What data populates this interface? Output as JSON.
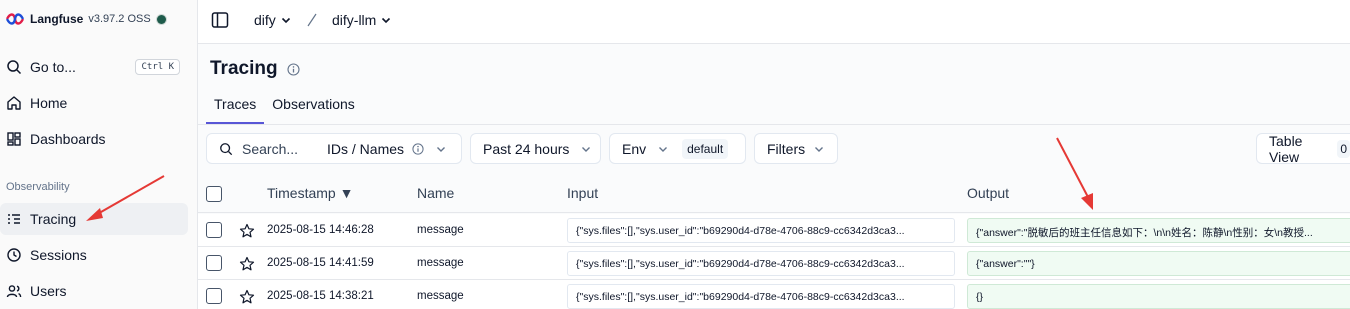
{
  "brand": {
    "name": "Langfuse",
    "version": "v3.97.2 OSS",
    "logo_icon": "langfuse-logo-icon",
    "status_color": "#1e5b4b"
  },
  "sidebar": {
    "goto": {
      "label": "Go to...",
      "shortcut": "Ctrl K",
      "icon": "search-icon"
    },
    "items": [
      {
        "label": "Home",
        "icon": "home-icon"
      },
      {
        "label": "Dashboards",
        "icon": "dashboard-icon"
      }
    ],
    "section_label": "Observability",
    "section_items": [
      {
        "label": "Tracing",
        "icon": "tracing-icon",
        "active": true
      },
      {
        "label": "Sessions",
        "icon": "clock-icon"
      },
      {
        "label": "Users",
        "icon": "users-icon"
      }
    ]
  },
  "topbar": {
    "project": "dify",
    "dataset": "dify-llm",
    "panel_icon": "sidebar-toggle-icon"
  },
  "page": {
    "title": "Tracing",
    "tabs": [
      {
        "label": "Traces",
        "active": true
      },
      {
        "label": "Observations",
        "active": false
      }
    ]
  },
  "toolbar": {
    "search_placeholder": "Search...",
    "search_mode": "IDs / Names",
    "time_range": "Past 24 hours",
    "env_label": "Env",
    "env_value": "default",
    "filters_label": "Filters",
    "view_label": "Table View",
    "view_count": "0"
  },
  "table": {
    "columns": {
      "timestamp": "Timestamp ▼",
      "name": "Name",
      "input": "Input",
      "output": "Output"
    },
    "rows": [
      {
        "timestamp": "2025-08-15 14:46:28",
        "name": "message",
        "input": "{\"sys.files\":[],\"sys.user_id\":\"b69290d4-d78e-4706-88c9-cc6342d3ca3...",
        "output": "{\"answer\":\"脱敏后的班主任信息如下：\\n\\n姓名：陈静\\n性别：女\\n教授..."
      },
      {
        "timestamp": "2025-08-15 14:41:59",
        "name": "message",
        "input": "{\"sys.files\":[],\"sys.user_id\":\"b69290d4-d78e-4706-88c9-cc6342d3ca3...",
        "output": "{\"answer\":\"\"}"
      },
      {
        "timestamp": "2025-08-15 14:38:21",
        "name": "message",
        "input": "{\"sys.files\":[],\"sys.user_id\":\"b69290d4-d78e-4706-88c9-cc6342d3ca3...",
        "output": "{}"
      }
    ]
  },
  "colors": {
    "accent": "#5856d6",
    "annotation": "#e53935",
    "output_bg": "#f0fbf3"
  }
}
